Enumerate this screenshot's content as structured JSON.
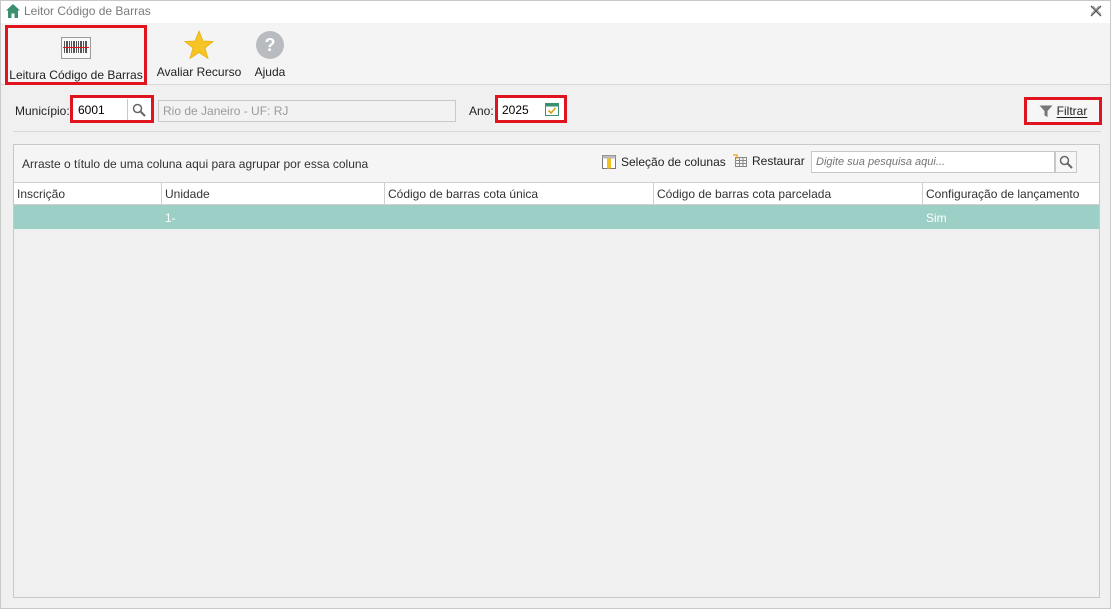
{
  "window": {
    "title": "Leitor Código de Barras"
  },
  "ribbon": {
    "barcode_label": "Leitura Código de Barras",
    "avaliar_label": "Avaliar Recurso",
    "ajuda_label": "Ajuda"
  },
  "filters": {
    "municipio_label": "Município:",
    "municipio_value": "6001",
    "municipio_desc": "Rio de Janeiro - UF: RJ",
    "ano_label": "Ano:",
    "ano_value": "2025",
    "filtrar_label": "Filtrar"
  },
  "grid": {
    "group_hint": "Arraste o título de uma coluna aqui para agrupar por essa coluna",
    "column_selection_label": "Seleção de colunas",
    "restore_label": "Restaurar",
    "search_placeholder": "Digite sua pesquisa aqui...",
    "columns": [
      "Inscrição",
      "Unidade",
      "Código de barras cota única",
      "Código de barras cota parcelada",
      "Configuração de lançamento"
    ],
    "rows": [
      {
        "inscricao": "",
        "unidade": "1-",
        "cota_unica": "",
        "cota_parcelada": "",
        "configuracao": "Sim"
      }
    ],
    "selected_row_color": "#9ccfc5"
  },
  "colors": {
    "highlight": "#e0141e",
    "accent": "#3a8f6e"
  }
}
